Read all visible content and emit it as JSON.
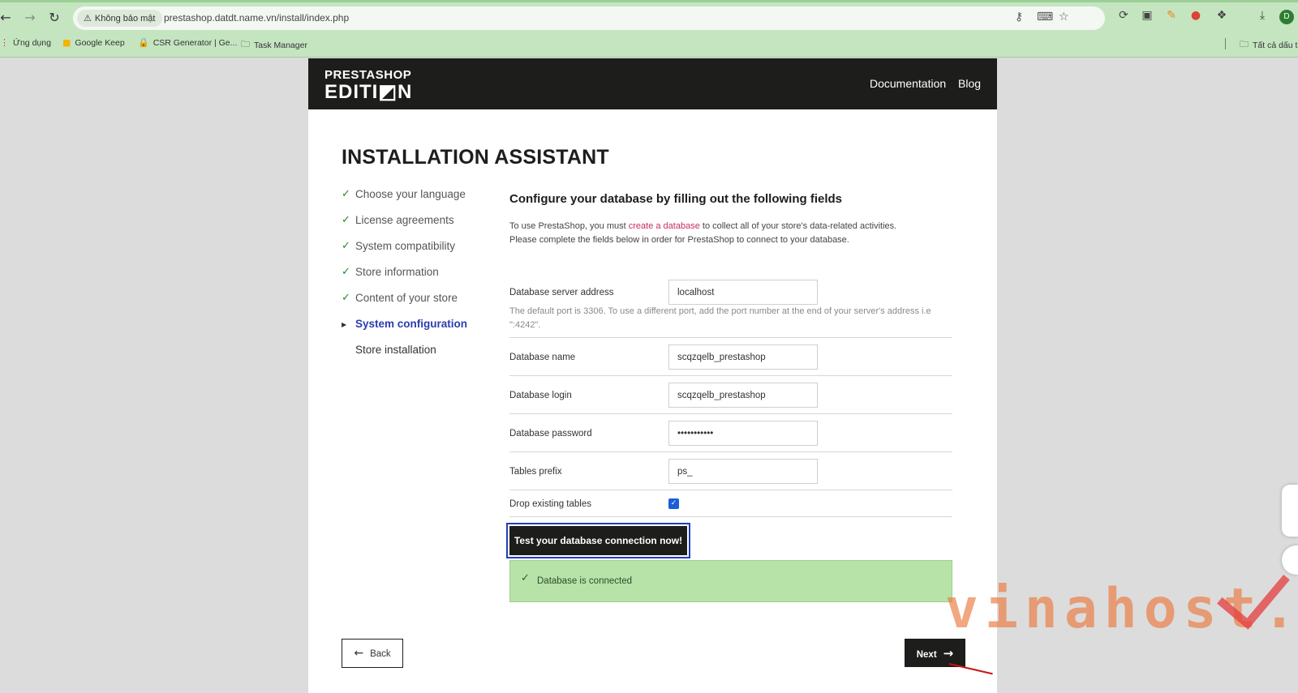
{
  "browser": {
    "security_label": "Không bảo mật",
    "url": "prestashop.datdt.name.vn/install/index.php",
    "profile_initial": "D",
    "bookmarks": [
      {
        "label": "Ứng dụng",
        "icon": "apps-grid-icon"
      },
      {
        "label": "Google Keep",
        "icon": "keep-icon"
      },
      {
        "label": "CSR Generator | Ge...",
        "icon": "lock-icon"
      },
      {
        "label": "Task Manager",
        "icon": "folder-icon"
      }
    ],
    "all_bookmarks_label": "Tất cả dấu t"
  },
  "header": {
    "logo_line1": "PRESTASHOP",
    "logo_line2": "EDITI◩N",
    "links": [
      "Documentation",
      "Blog"
    ]
  },
  "page_title": "INSTALLATION ASSISTANT",
  "steps": [
    {
      "label": "Choose your language",
      "state": "done"
    },
    {
      "label": "License agreements",
      "state": "done"
    },
    {
      "label": "System compatibility",
      "state": "done"
    },
    {
      "label": "Store information",
      "state": "done"
    },
    {
      "label": "Content of your store",
      "state": "done"
    },
    {
      "label": "System configuration",
      "state": "active"
    },
    {
      "label": "Store installation",
      "state": "pending"
    }
  ],
  "form": {
    "heading": "Configure your database by filling out the following fields",
    "intro_before": "To use PrestaShop, you must ",
    "intro_link": "create a database",
    "intro_after": " to collect all of your store's data-related activities.",
    "intro_line2": "Please complete the fields below in order for PrestaShop to connect to your database.",
    "server_label": "Database server address",
    "server_value": "localhost",
    "server_hint": "The default port is 3306. To use a different port, add the port number at the end of your server's address i.e \":4242\".",
    "dbname_label": "Database name",
    "dbname_value": "scqzqelb_prestashop",
    "login_label": "Database login",
    "login_value": "scqzqelb_prestashop",
    "password_label": "Database password",
    "password_value": "•••••••••••",
    "prefix_label": "Tables prefix",
    "prefix_value": "ps_",
    "drop_label": "Drop existing tables",
    "drop_checked": true,
    "test_button": "Test your database connection now!",
    "success_message": "Database is connected"
  },
  "nav": {
    "back_label": "Back",
    "next_label": "Next"
  },
  "watermark": "vinahost."
}
